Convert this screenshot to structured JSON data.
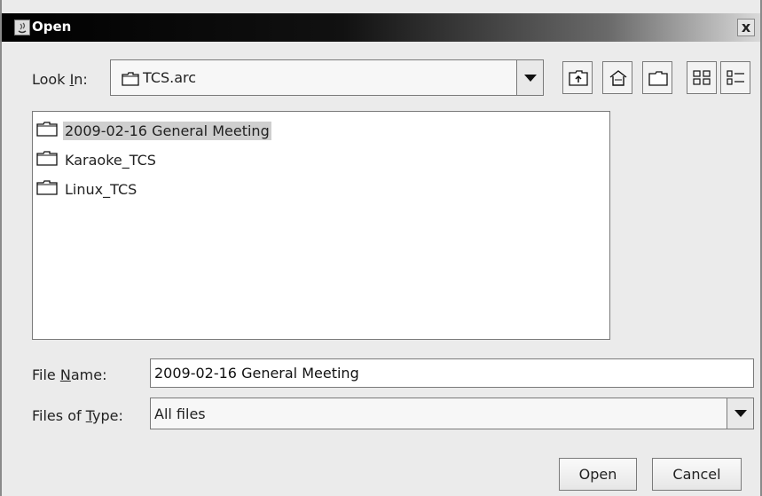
{
  "window": {
    "title": "Open",
    "close_label": "x"
  },
  "look_in": {
    "label_pre": "Look ",
    "label_mnemonic": "I",
    "label_post": "n:",
    "value": "TCS.arc"
  },
  "toolbar": {
    "icons": [
      "up-one-level-icon",
      "home-icon",
      "new-folder-icon",
      "list-view-icon",
      "details-view-icon"
    ]
  },
  "files": [
    {
      "name": "2009-02-16 General Meeting",
      "selected": true
    },
    {
      "name": "Karaoke_TCS",
      "selected": false
    },
    {
      "name": "Linux_TCS",
      "selected": false
    }
  ],
  "file_name": {
    "label_pre": "File ",
    "label_mnemonic": "N",
    "label_post": "ame:",
    "value": "2009-02-16 General Meeting"
  },
  "file_type": {
    "label_pre": "Files of ",
    "label_mnemonic": "T",
    "label_post": "ype:",
    "value": "All files"
  },
  "buttons": {
    "open": "Open",
    "cancel": "Cancel"
  }
}
